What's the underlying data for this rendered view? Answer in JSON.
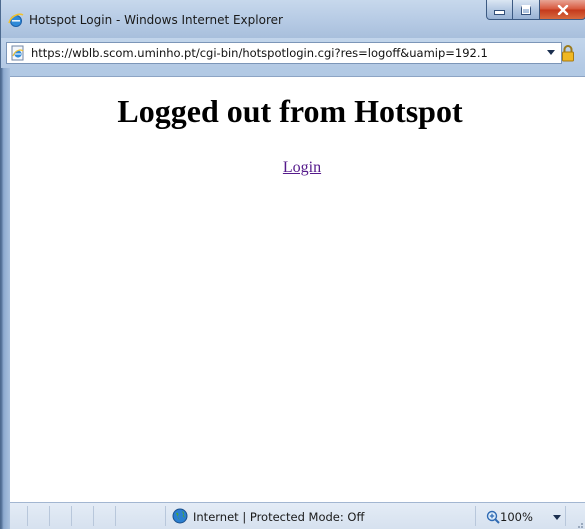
{
  "window": {
    "title": "Hotspot Login - Windows Internet Explorer",
    "title_icon": "ie-logo-icon"
  },
  "addressbar": {
    "url": "https://wblb.scom.uminho.pt/cgi-bin/hotspotlogin.cgi?res=logoff&uamip=192.1",
    "page_icon": "ie-page-icon",
    "security_icon": "lock-icon"
  },
  "page": {
    "heading": "Logged out from Hotspot",
    "login_link": "Login",
    "link_color": "#551a8b"
  },
  "statusbar": {
    "zone_text": "Internet | Protected Mode: Off",
    "zone_icon": "globe-icon",
    "zoom_label": "100%",
    "zoom_icon": "zoom-icon"
  },
  "colors": {
    "frame": "#a9c2df",
    "close_button": "#c4391c"
  }
}
